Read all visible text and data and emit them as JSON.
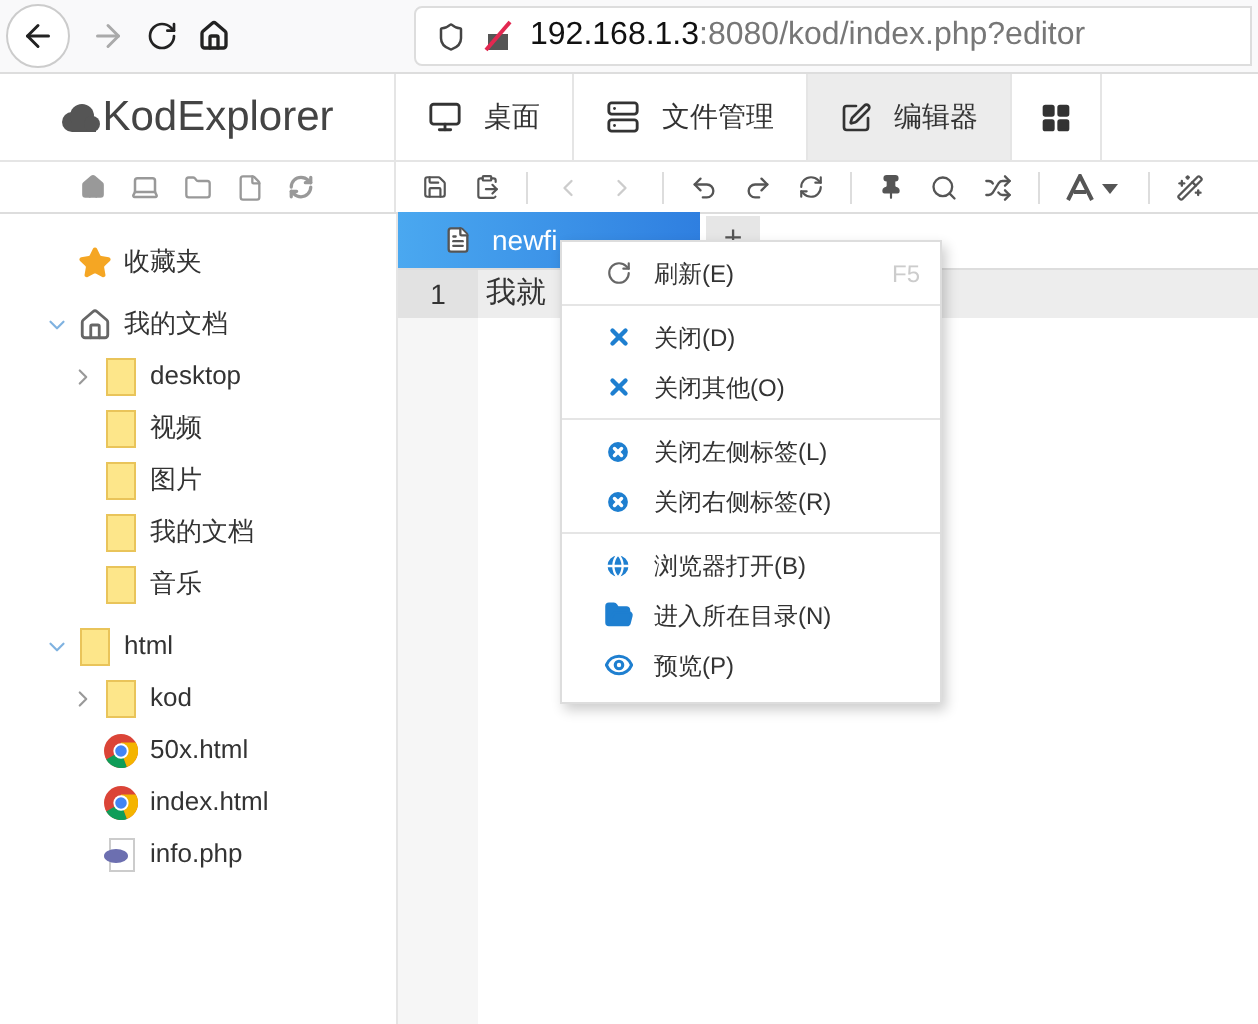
{
  "browser": {
    "url_host": "192.168.1.3",
    "url_rest": ":8080/kod/index.php?editor"
  },
  "app": {
    "logo": "KodExplorer",
    "nav_tabs": [
      {
        "kind": "monitor",
        "label": "桌面",
        "selected": false
      },
      {
        "kind": "server",
        "label": "文件管理",
        "selected": false
      },
      {
        "kind": "edit",
        "label": "编辑器",
        "selected": true
      },
      {
        "kind": "grid",
        "selected": false
      }
    ]
  },
  "tree": [
    {
      "kind": "star",
      "label": "收藏夹"
    },
    {
      "kind": "home",
      "label": "我的文档",
      "expanded": true,
      "children": [
        {
          "kind": "folder",
          "label": "desktop",
          "expanded": false
        },
        {
          "kind": "folder",
          "label": "视频"
        },
        {
          "kind": "folder",
          "label": "图片"
        },
        {
          "kind": "folder",
          "label": "我的文档"
        },
        {
          "kind": "folder",
          "label": "音乐"
        }
      ]
    },
    {
      "kind": "folder",
      "label": "html",
      "expanded": true,
      "children": [
        {
          "kind": "folder",
          "label": "kod",
          "expanded": false
        },
        {
          "kind": "chrome",
          "label": "50x.html"
        },
        {
          "kind": "chrome",
          "label": "index.html"
        },
        {
          "kind": "php",
          "label": "info.php"
        }
      ]
    }
  ],
  "editor": {
    "tabs": [
      {
        "label": "newfi",
        "selected": true
      }
    ],
    "add_tab": "+",
    "lines": [
      {
        "number": "1",
        "text": "我就"
      }
    ]
  },
  "context_menu": [
    {
      "items": [
        {
          "kind": "refresh",
          "label": "刷新(E)",
          "shortcut": "F5"
        }
      ]
    },
    {
      "items": [
        {
          "kind": "x",
          "label": "关闭(D)"
        },
        {
          "kind": "x",
          "label": "关闭其他(O)"
        }
      ]
    },
    {
      "items": [
        {
          "kind": "xcircle",
          "label": "关闭左侧标签(L)"
        },
        {
          "kind": "xcircle",
          "label": "关闭右侧标签(R)"
        }
      ]
    },
    {
      "items": [
        {
          "kind": "globe",
          "label": "浏览器打开(B)"
        },
        {
          "kind": "folderopen",
          "label": "进入所在目录(N)"
        },
        {
          "kind": "eye",
          "label": "预览(P)"
        }
      ]
    }
  ]
}
